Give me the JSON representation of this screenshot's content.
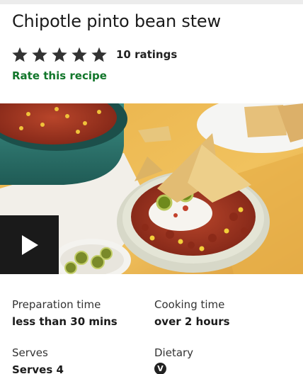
{
  "recipe": {
    "title": "Chipotle pinto bean stew",
    "rating": {
      "stars_filled": 5,
      "stars_total": 5,
      "count_label": "10 ratings",
      "star_color": "#333333"
    },
    "rate_link": "Rate this recipe",
    "accent_color": "#11762a"
  },
  "media": {
    "play_icon": "play-icon"
  },
  "info": {
    "prep_label": "Preparation time",
    "prep_value": "less than 30 mins",
    "cook_label": "Cooking time",
    "cook_value": "over 2 hours",
    "serves_label": "Serves",
    "serves_value": "Serves 4",
    "dietary_label": "Dietary",
    "dietary_icon": "vegetarian-icon",
    "dietary_icon_text": "V"
  }
}
